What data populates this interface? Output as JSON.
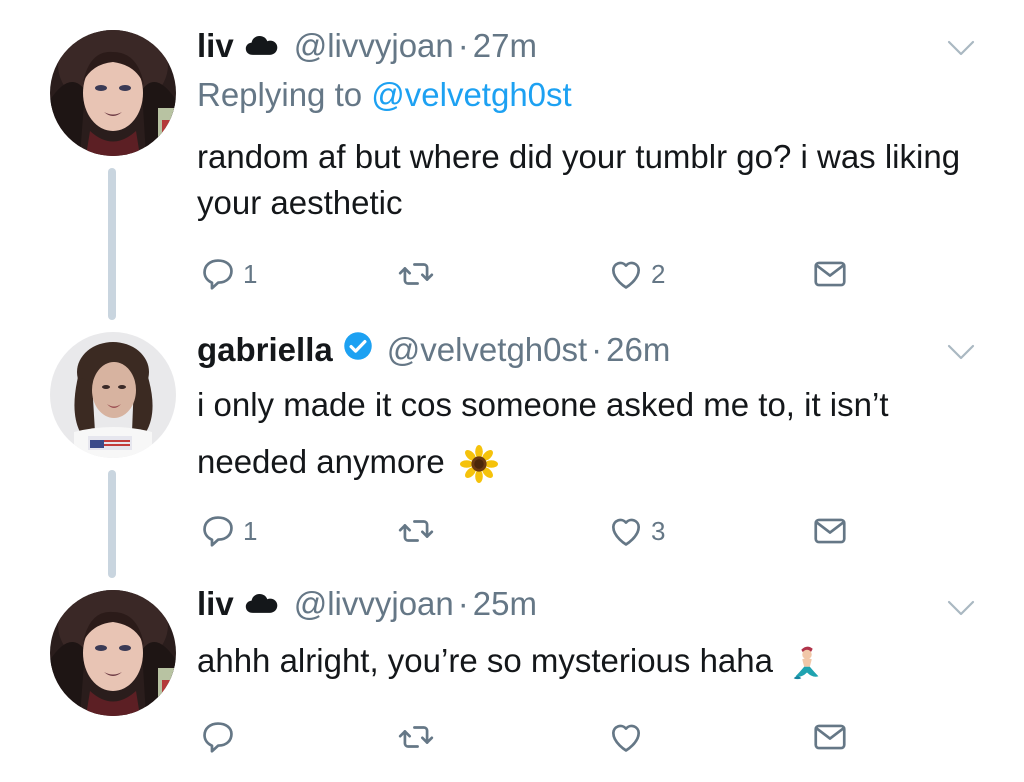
{
  "tweets": [
    {
      "name": "liv",
      "handle": "@livvyjoan",
      "time": "27m",
      "reply_prefix": "Replying to ",
      "reply_handle": "@velvetgh0st",
      "text": "random af but where did your tumblr go? i was liking your aesthetic",
      "reply_count": "1",
      "retweet_count": "",
      "like_count": "2"
    },
    {
      "name": "gabriella",
      "handle": "@velvetgh0st",
      "time": "26m",
      "text": "i only made it cos someone asked me to, it isn’t needed anymore",
      "reply_count": "1",
      "retweet_count": "",
      "like_count": "3"
    },
    {
      "name": "liv",
      "handle": "@livvyjoan",
      "time": "25m",
      "text": "ahhh alright, you’re so mysterious haha",
      "reply_count": "",
      "retweet_count": "",
      "like_count": ""
    }
  ],
  "separator": "·",
  "icons": {
    "name_glyph": "cloud-icon",
    "verified": "verified-badge-icon",
    "sunflower": "sunflower-emoji",
    "mermaid": "mermaid-emoji",
    "reply": "reply-icon",
    "retweet": "retweet-icon",
    "like": "like-icon",
    "dm": "direct-message-icon",
    "more": "chevron-down-icon"
  },
  "colors": {
    "text": "#14171a",
    "muted": "#657786",
    "link": "#1da1f2",
    "thread_line": "#c9d5df",
    "verified": "#1da1f2"
  }
}
